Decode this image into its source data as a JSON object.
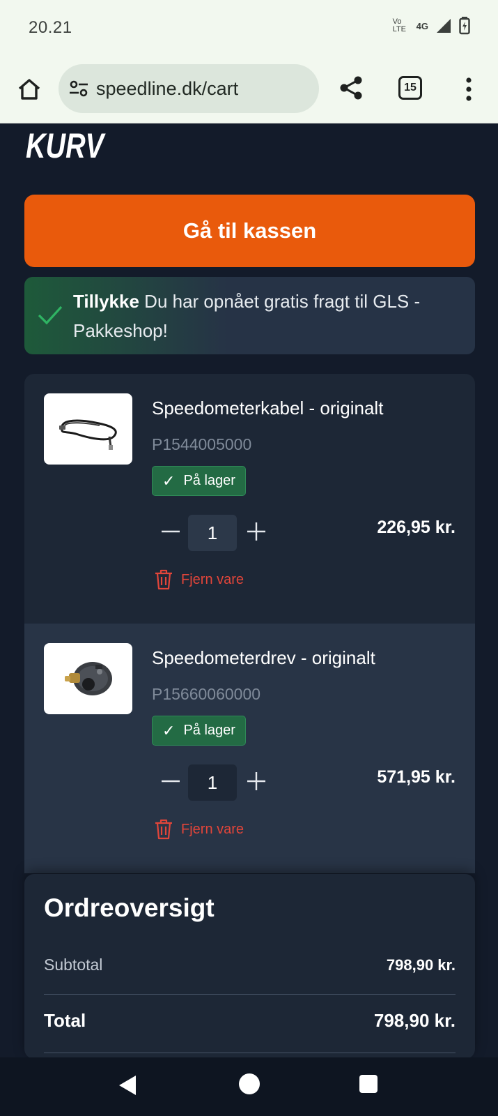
{
  "status_bar": {
    "time": "20.21",
    "volte_label": "Vo LTE",
    "network": "4G"
  },
  "browser": {
    "url": "speedline.dk/cart",
    "tab_count": "15"
  },
  "page": {
    "logo_text": "KURV",
    "checkout_label": "Gå til kassen"
  },
  "notice": {
    "strong": "Tillykke",
    "text": " Du har opnået gratis fragt til GLS - Pakkeshop!"
  },
  "cart": {
    "items": [
      {
        "name": "Speedometerkabel - originalt",
        "sku": "P1544005000",
        "stock": "På lager",
        "quantity": "1",
        "price": "226,95 kr.",
        "remove_label": "Fjern vare"
      },
      {
        "name": "Speedometerdrev - originalt",
        "sku": "P15660060000",
        "stock": "På lager",
        "quantity": "1",
        "price": "571,95 kr.",
        "remove_label": "Fjern vare"
      }
    ]
  },
  "summary": {
    "title": "Ordreoversigt",
    "subtotal_label": "Subtotal",
    "subtotal_value": "798,90 kr.",
    "total_label": "Total",
    "total_value": "798,90 kr."
  },
  "colors": {
    "background": "#131b2a",
    "accent": "#e95a0c",
    "success": "#236b44",
    "danger": "#e2453a"
  }
}
